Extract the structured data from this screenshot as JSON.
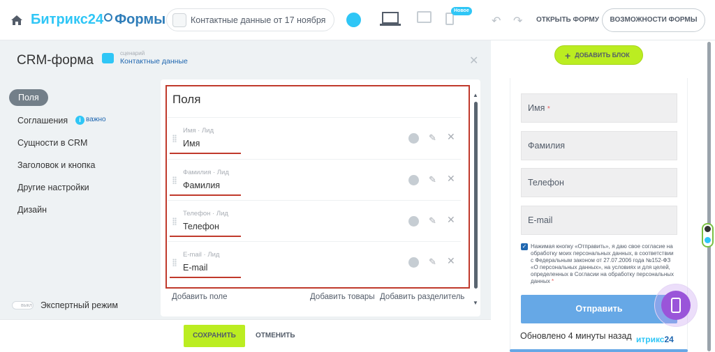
{
  "header": {
    "logo_b24": "Битрикс24",
    "logo_forms": "Формы",
    "form_selector": "Контактные данные от 17 ноября",
    "new_badge": "Новое",
    "open_form": "ОТКРЫТЬ ФОРМУ",
    "features": "ВОЗМОЖНОСТИ ФОРМЫ"
  },
  "editor": {
    "title": "CRM-форма",
    "scenario_label": "сценарий",
    "scenario_value": "Контактные данные",
    "nav": [
      "Поля",
      "Соглашения",
      "Сущности в CRM",
      "Заголовок и кнопка",
      "Другие настройки",
      "Дизайн"
    ],
    "important": "важно",
    "expert_toggle": "выкл",
    "expert_mode": "Экспертный режим"
  },
  "fields_panel": {
    "heading": "Поля",
    "fields": [
      {
        "sub": "Имя · Лид",
        "name": "Имя"
      },
      {
        "sub": "Фамилия · Лид",
        "name": "Фамилия"
      },
      {
        "sub": "Телефон · Лид",
        "name": "Телефон"
      },
      {
        "sub": "E-mail · Лид",
        "name": "E-mail"
      }
    ],
    "add_field": "Добавить поле",
    "add_products": "Добавить товары",
    "add_separator": "Добавить разделитель"
  },
  "footer": {
    "save": "СОХРАНИТЬ",
    "cancel": "ОТМЕНИТЬ"
  },
  "preview": {
    "add_block": "ДОБАВИТЬ БЛОК",
    "inputs": [
      "Имя",
      "Фамилия",
      "Телефон",
      "E-mail"
    ],
    "required_mark": "*",
    "consent": "Нажимая кнопку «Отправить», я даю свое согласие на обработку моих персональных данных, в соответствии с Федеральным законом от 27.07.2006 года №152-ФЗ «О персональных данных», на условиях и для целей, определенных в Согласии на обработку персональных данных",
    "send": "Отправить",
    "updated": "Обновлено 4 минуты назад",
    "brand": "итрикс",
    "brand_num": "24"
  },
  "colors": {
    "accent": "#2fc6f6",
    "brand_dark": "#2f7db9",
    "save_green": "#bbed21",
    "highlight_red": "#c0392b",
    "send_blue": "#66a8e6",
    "mobile_purple": "#9a55d9"
  },
  "icons": [
    "home-icon",
    "clock-icon",
    "form-icon",
    "cloud-icon",
    "laptop-icon",
    "tablet-icon",
    "phone-icon",
    "undo-icon",
    "redo-icon",
    "close-icon",
    "scenario-icon",
    "info-icon",
    "drag-handle-icon",
    "person-icon",
    "edit-icon",
    "delete-icon",
    "plus-icon",
    "checkbox-icon",
    "mobile-icon"
  ]
}
